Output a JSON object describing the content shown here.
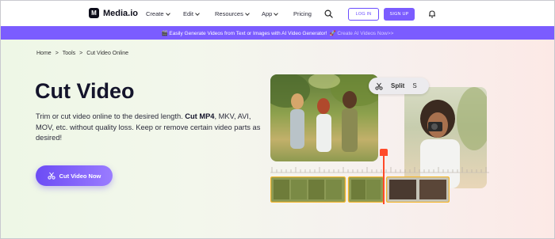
{
  "header": {
    "brand": "Media.io",
    "logo_letter": "M",
    "nav": [
      {
        "label": "Create"
      },
      {
        "label": "Edit"
      },
      {
        "label": "Resources"
      },
      {
        "label": "App"
      },
      {
        "label": "Pricing"
      }
    ],
    "login_label": "LOG IN",
    "signup_label": "SIGN UP"
  },
  "banner": {
    "text": "🎬 Easily Generate Videos from Text or Images with AI Video Generator!",
    "cta": "🚀 Create AI Videos Now>>"
  },
  "breadcrumb": {
    "items": [
      "Home",
      "Tools",
      "Cut Video Online"
    ],
    "separator": ">"
  },
  "hero": {
    "title": "Cut Video",
    "desc_pre": "Trim or cut video online to the desired length. ",
    "desc_bold": "Cut MP4",
    "desc_post": ", MKV, AVI, MOV, etc. without quality loss. Keep or remove certain video parts as desired!",
    "cta_label": "Cut Video Now"
  },
  "illustration": {
    "split_label": "Split",
    "split_key": "S"
  },
  "colors": {
    "accent": "#7b5cff",
    "playhead": "#ff4a2a",
    "clip_border": "#f5b62a"
  },
  "icons": {
    "search": "search-icon",
    "bell": "bell-icon",
    "scissors": "scissors-icon"
  }
}
